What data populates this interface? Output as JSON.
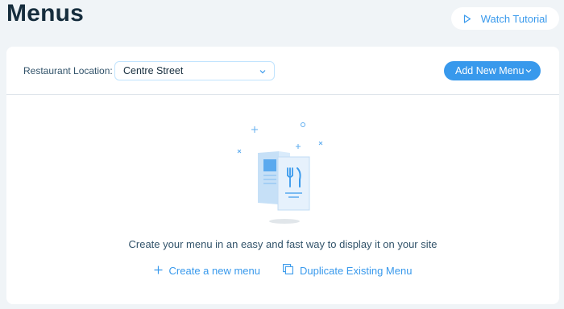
{
  "header": {
    "title": "Menus",
    "tutorial_label": "Watch Tutorial"
  },
  "toolbar": {
    "location_label": "Restaurant Location:",
    "location_value": "Centre Street",
    "add_menu_label": "Add New Menu"
  },
  "empty_state": {
    "message": "Create your menu in an easy and fast way to display it on your site",
    "create_label": "Create a new menu",
    "duplicate_label": "Duplicate Existing Menu"
  },
  "icons": {
    "tutorial": "play-icon",
    "location_dropdown": "chevron-down-icon",
    "add_menu_dropdown": "chevron-down-icon",
    "create": "plus-icon",
    "duplicate": "duplicate-icon",
    "illustration": "menu-illustration"
  },
  "colors": {
    "accent": "#3899ec",
    "background": "#f0f4f7",
    "title": "#162d3d"
  }
}
